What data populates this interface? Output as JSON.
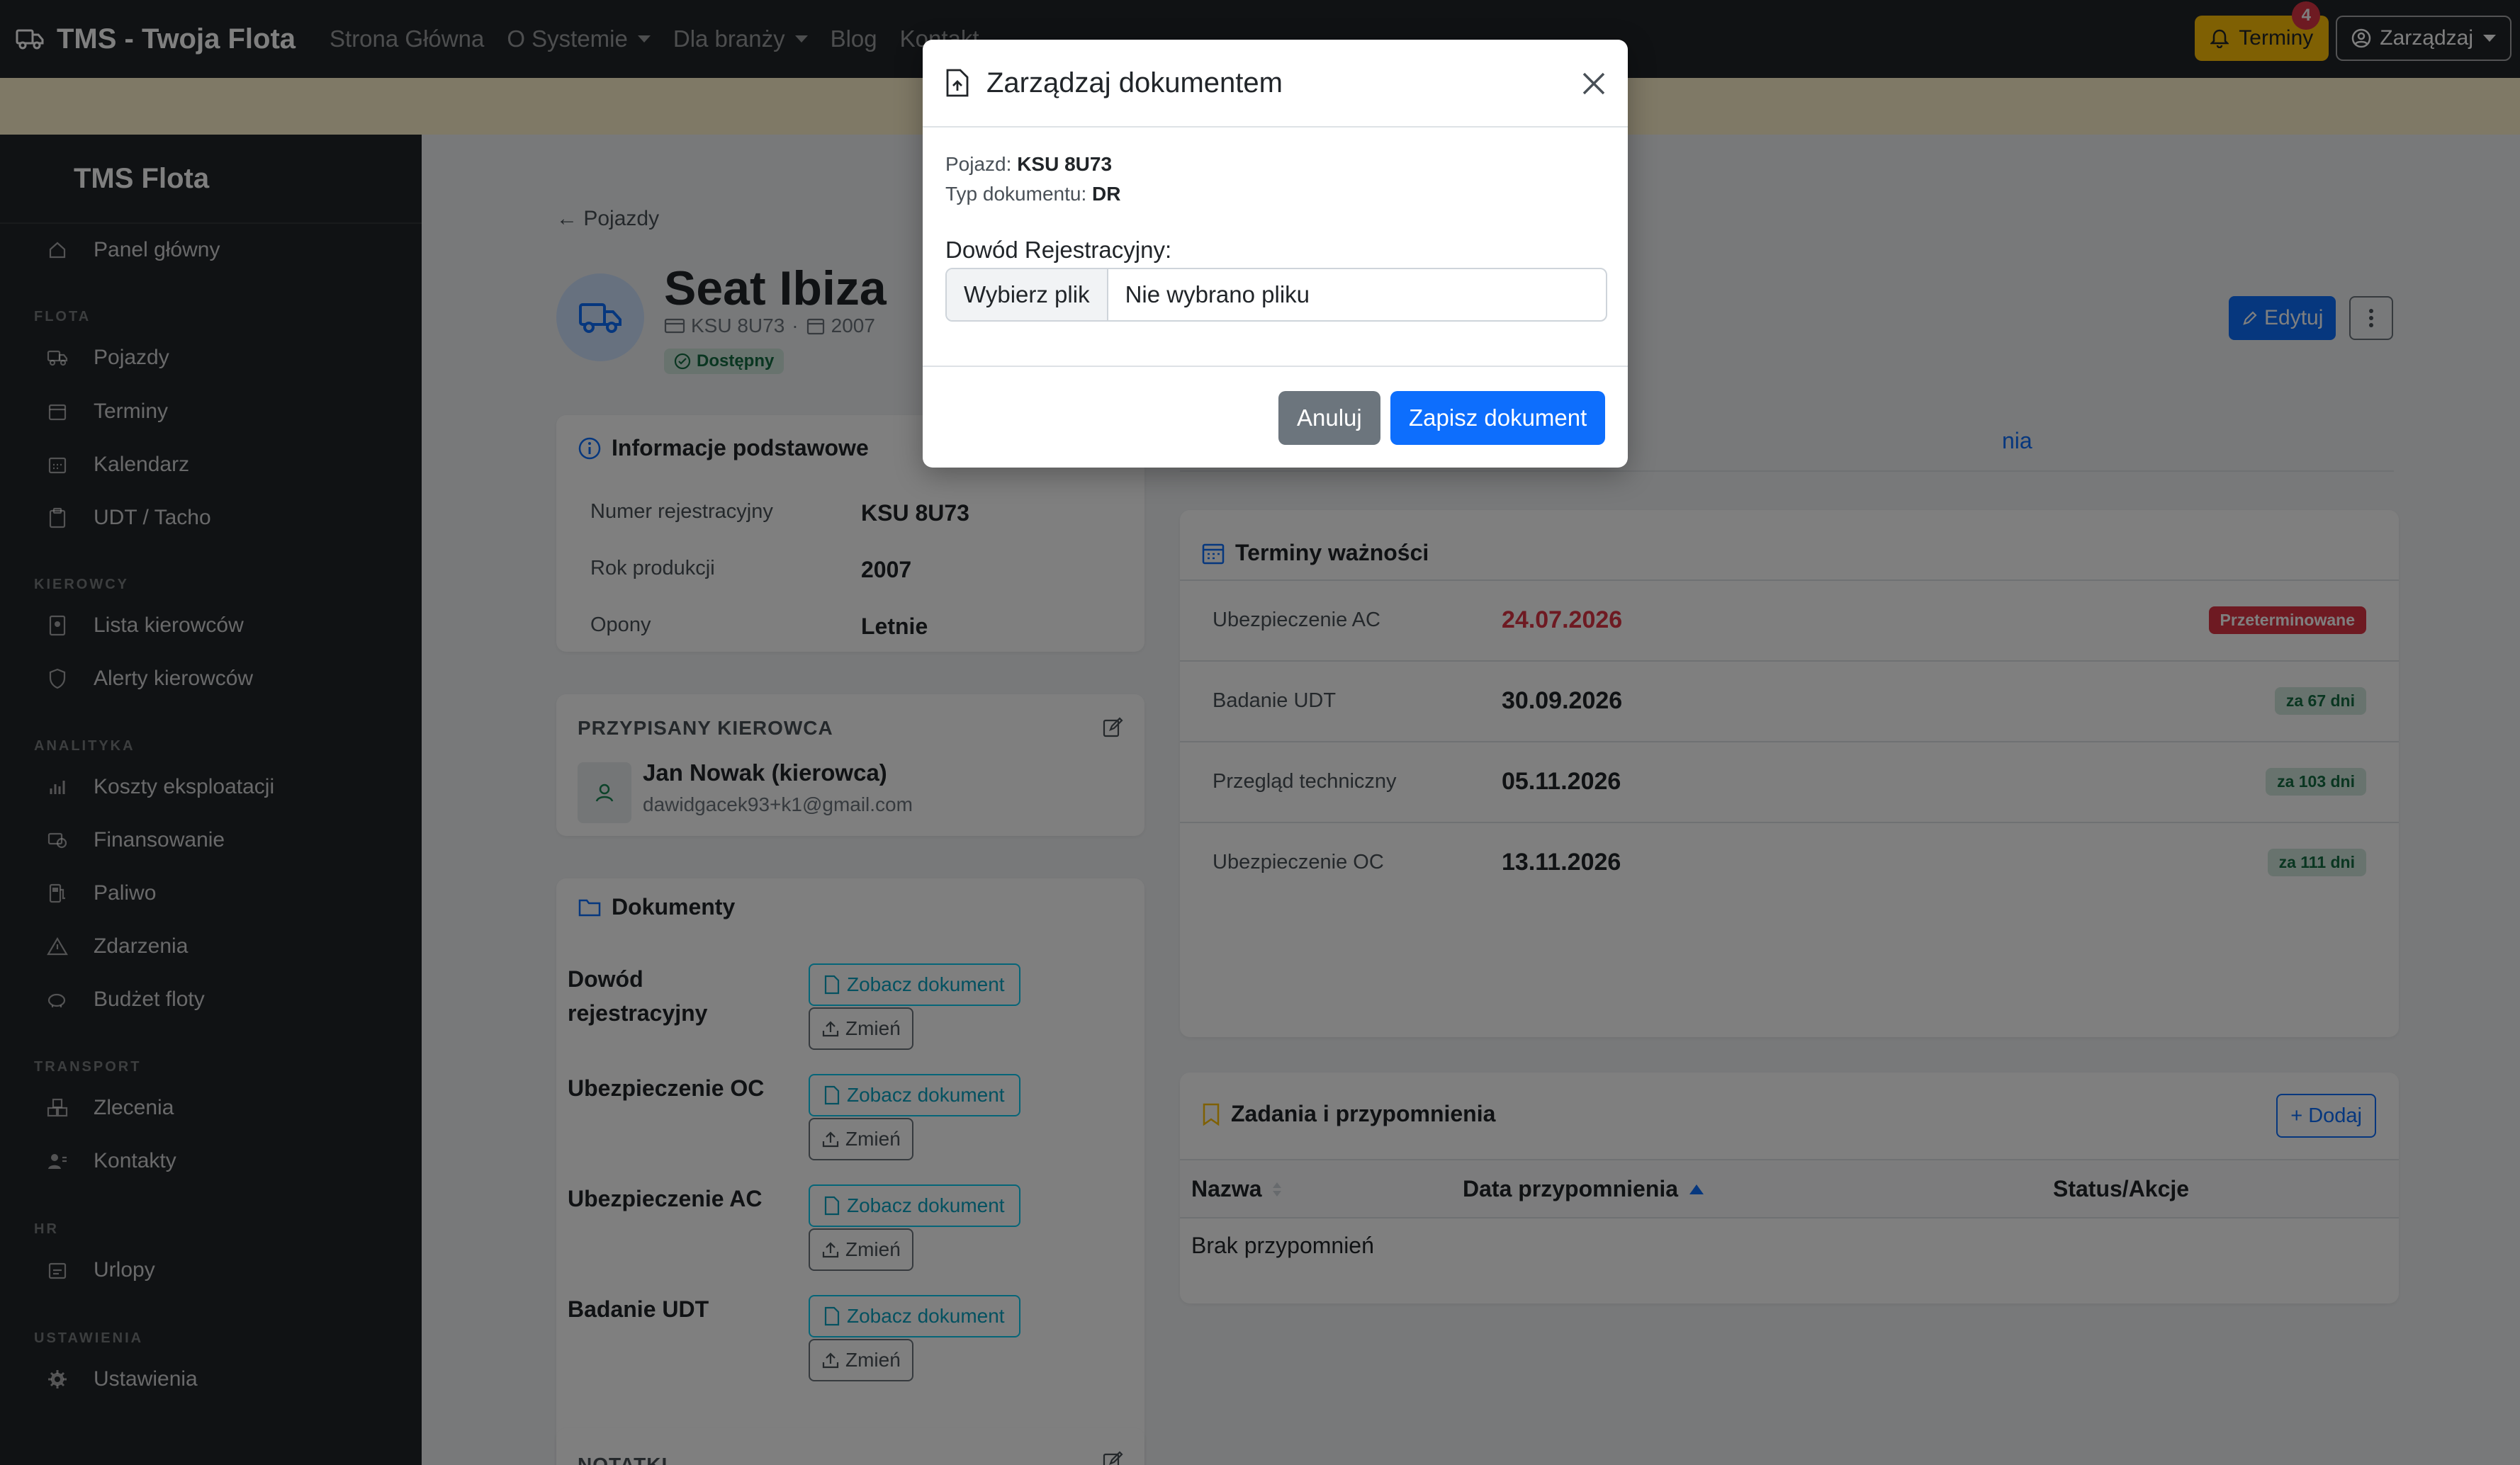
{
  "topnav": {
    "brand": "TMS - Twoja Flota",
    "links": [
      "Strona Główna",
      "O Systemie",
      "Dla branży",
      "Blog",
      "Kontakt"
    ],
    "terminy_label": "Terminy",
    "terminy_count": "4",
    "manage_label": "Zarządzaj"
  },
  "sidebar": {
    "title": "TMS Flota",
    "items": {
      "panel": "Panel główny",
      "pojazdy": "Pojazdy",
      "terminy": "Terminy",
      "kalendarz": "Kalendarz",
      "udt": "UDT / Tacho",
      "lista_kierowcow": "Lista kierowców",
      "alerty": "Alerty kierowców",
      "koszty": "Koszty eksploatacji",
      "finansowanie": "Finansowanie",
      "paliwo": "Paliwo",
      "zdarzenia": "Zdarzenia",
      "budzet": "Budżet floty",
      "zlecenia": "Zlecenia",
      "kontakty": "Kontakty",
      "urlopy": "Urlopy",
      "ustawienia": "Ustawienia"
    },
    "sections": {
      "flota": "FLOTA",
      "kierowcy": "KIEROWCY",
      "analityka": "ANALITYKA",
      "transport": "TRANSPORT",
      "hr": "HR",
      "ustawienia": "USTAWIENIA"
    }
  },
  "vehicle": {
    "back": "← Pojazdy",
    "name": "Seat Ibiza",
    "plate": "KSU 8U73",
    "year": "2007",
    "status": "Dostępny",
    "edit_label": "Edytuj"
  },
  "basic_info": {
    "title": "Informacje podstawowe",
    "rows": [
      {
        "label": "Numer rejestracyjny",
        "value": "KSU 8U73"
      },
      {
        "label": "Rok produkcji",
        "value": "2007"
      },
      {
        "label": "Opony",
        "value": "Letnie"
      }
    ]
  },
  "driver": {
    "title": "PRZYPISANY KIEROWCA",
    "name": "Jan Nowak (kierowca)",
    "email": "dawidgacek93+k1@gmail.com"
  },
  "documents": {
    "title": "Dokumenty",
    "view_label": "Zobacz dokument",
    "change_label": "Zmień",
    "items": [
      "Dowód\nrejestracyjny",
      "Ubezpieczenie OC",
      "Ubezpieczenie AC",
      "Badanie UDT"
    ]
  },
  "notes": {
    "title": "NOTATKI"
  },
  "tabs": {
    "partial": "nia"
  },
  "terms": {
    "title": "Terminy ważności",
    "rows": [
      {
        "label": "Ubezpieczenie AC",
        "date": "24.07.2026",
        "badge": "Przeterminowane"
      },
      {
        "label": "Badanie UDT",
        "date": "30.09.2026",
        "badge": "za 67 dni"
      },
      {
        "label": "Przegląd techniczny",
        "date": "05.11.2026",
        "badge": "za 103 dni"
      },
      {
        "label": "Ubezpieczenie OC",
        "date": "13.11.2026",
        "badge": "za 111 dni"
      }
    ]
  },
  "tasks": {
    "title": "Zadania i przypomnienia",
    "add_label": "+ Dodaj",
    "col_name": "Nazwa",
    "col_date": "Data przypomnienia",
    "col_status": "Status/Akcje",
    "empty": "Brak przypomnień"
  },
  "modal": {
    "title": "Zarządzaj dokumentem",
    "vehicle_label": "Pojazd:",
    "vehicle_value": "KSU 8U73",
    "doc_type_label": "Typ dokumentu:",
    "doc_type_value": "DR",
    "field_label": "Dowód Rejestracyjny:",
    "file_button": "Wybierz plik",
    "file_text": "Nie wybrano pliku",
    "cancel_label": "Anuluj",
    "save_label": "Zapisz dokument"
  }
}
